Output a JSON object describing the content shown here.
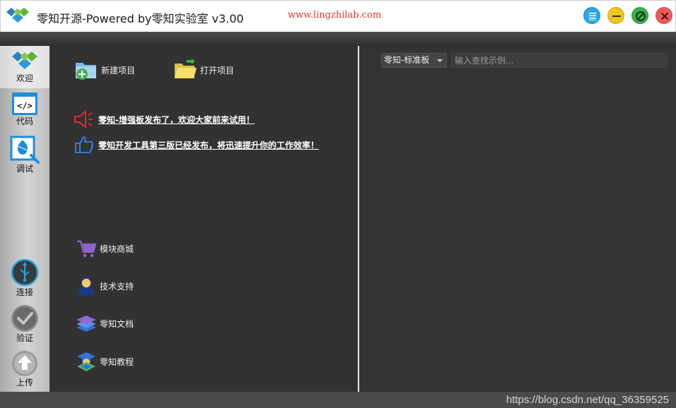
{
  "window": {
    "title": "零知开源-Powered by零知实验室 v3.00",
    "url": "www.lingzhilab.com",
    "buttons": [
      "menu-icon",
      "minimize-icon",
      "maximize-icon",
      "close-icon"
    ]
  },
  "sidebar": {
    "items": [
      {
        "label": "欢迎",
        "icon": "welcome-logo-icon",
        "active": true
      },
      {
        "label": "代码",
        "icon": "code-icon"
      },
      {
        "label": "调试",
        "icon": "debug-icon"
      },
      {
        "label": "连接",
        "icon": "usb-icon"
      },
      {
        "label": "验证",
        "icon": "check-icon"
      },
      {
        "label": "上传",
        "icon": "upload-icon"
      }
    ]
  },
  "main": {
    "new_project": "新建项目",
    "open_project": "打开项目",
    "notices": [
      "零知-增强板发布了，欢迎大家前来试用！",
      "零知开发工具第三版已经发布，将迅速提升你的工作效率！"
    ],
    "links": [
      {
        "label": "模块商城",
        "icon": "cart-icon"
      },
      {
        "label": "技术支持",
        "icon": "support-icon"
      },
      {
        "label": "零知文档",
        "icon": "docs-icon"
      },
      {
        "label": "零知教程",
        "icon": "tutorial-icon"
      }
    ]
  },
  "examples": {
    "board_select": "零知-标准板",
    "search_placeholder": "输入查找示例..."
  },
  "status": {
    "watermark": "https://blog.csdn.net/qq_36359525"
  },
  "colors": {
    "accent_blue": "#2ba6e6",
    "url_red": "#e0352b",
    "panel_dark": "#323232"
  }
}
